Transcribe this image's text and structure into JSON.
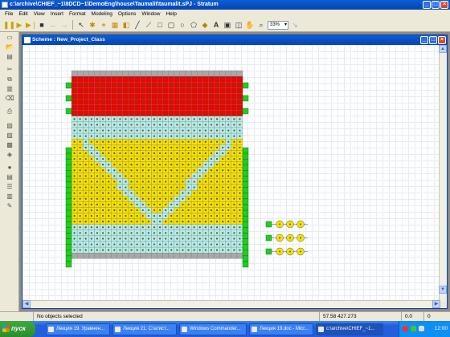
{
  "window": {
    "title": "c:\\archive\\CHIEF_~1\\8DCD~1\\DemoEng\\house\\Taumalit\\taumalit.sPJ - Stratum"
  },
  "menu": [
    "File",
    "Edit",
    "View",
    "Insert",
    "Format",
    "Modeling",
    "Options",
    "Window",
    "Help"
  ],
  "toolbar": {
    "zoom": "33%"
  },
  "scheme": {
    "title": "Scheme : New_Project_Class",
    "colors": {
      "red": "#ee0000",
      "yellow": "#f5e000",
      "cyan": "#b4ecec",
      "gray": "#a8a8a8",
      "green": "#22cc22",
      "node": "#5a5a00"
    }
  },
  "status": {
    "message": "No objects selected",
    "coords": "57.58 427.273",
    "v1": "0.0",
    "v2": "0"
  },
  "taskbar": {
    "start": "пуск",
    "tasks": [
      "Лекция 19. Уравнен...",
      "Лекция 21. Статист...",
      "Windows Commander...",
      "Лекция 19.doc - Micr...",
      "c:\\archive\\CHIEF_~1..."
    ],
    "clock": "12:00"
  }
}
